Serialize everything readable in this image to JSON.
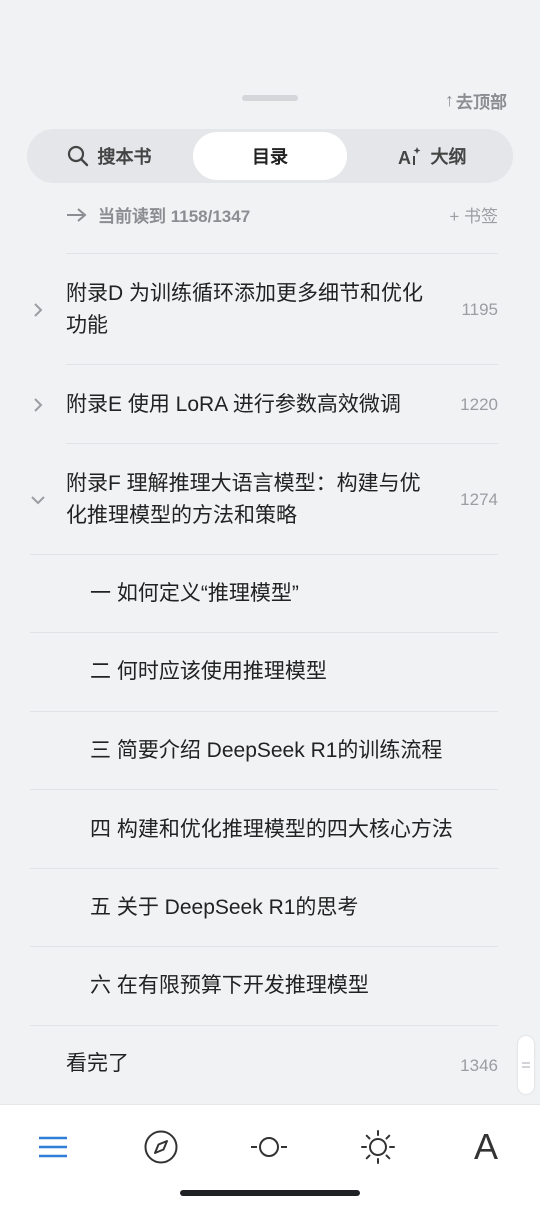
{
  "header": {
    "goto_top_label": "去顶部",
    "goto_top_arrow": "↑"
  },
  "segments": [
    {
      "label": "搜本书",
      "icon": "search-icon",
      "active": false
    },
    {
      "label": "目录",
      "icon": "",
      "active": true
    },
    {
      "label": "大纲",
      "icon": "outline-ai-icon",
      "active": false
    }
  ],
  "current": {
    "label": "当前读到 1158/1347",
    "bookmark_label": "+ 书签"
  },
  "toc": [
    {
      "title": "附录D 为训练循环添加更多细节和优化功能",
      "page": "1195",
      "expanded": false
    },
    {
      "title": "附录E 使用 LoRA 进行参数高效微调",
      "page": "1220",
      "expanded": false
    },
    {
      "title": "附录F 理解推理大语言模型：构建与优化推理模型的方法和策略",
      "page": "1274",
      "expanded": true
    },
    {
      "title": "一 如何定义“推理模型”",
      "page": ""
    },
    {
      "title": "二 何时应该使用推理模型",
      "page": ""
    },
    {
      "title": "三 简要介绍 DeepSeek R1的训练流程",
      "page": ""
    },
    {
      "title": "四 构建和优化推理模型的四大核心方法",
      "page": ""
    },
    {
      "title": "五 关于 DeepSeek R1的思考",
      "page": ""
    },
    {
      "title": "六 在有限预算下开发推理模型",
      "page": ""
    },
    {
      "title": "看完了",
      "page": "1346"
    }
  ],
  "tabbar": {
    "items": [
      "menu-icon",
      "compass-icon",
      "progress-icon",
      "brightness-icon",
      "font-icon"
    ],
    "font_glyph": "A",
    "active_color": "#2f7fd8",
    "inactive_color": "#333333"
  }
}
